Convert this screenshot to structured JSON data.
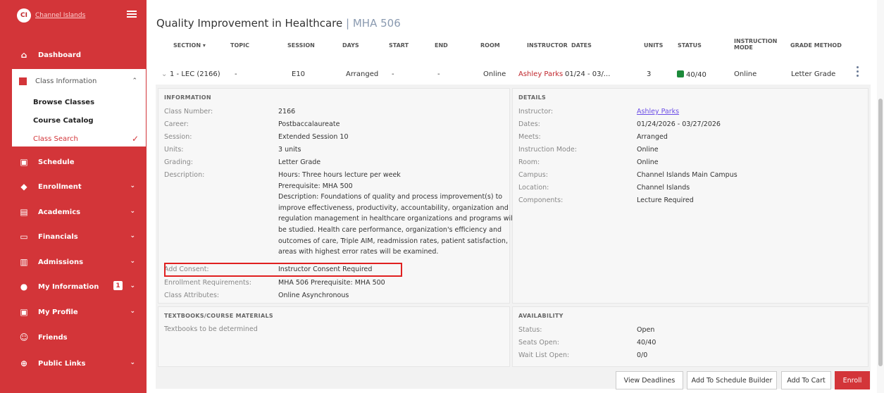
{
  "sidebar": {
    "logo_initials": "CI",
    "logo_text": "Channel Islands",
    "items": [
      {
        "label": "Dashboard",
        "icon": "home-icon"
      },
      {
        "label": "Class Information",
        "icon": "class-info-icon"
      },
      {
        "label": "Schedule",
        "icon": "calendar-icon"
      },
      {
        "label": "Enrollment",
        "icon": "graduation-cap-icon"
      },
      {
        "label": "Academics",
        "icon": "academics-icon"
      },
      {
        "label": "Financials",
        "icon": "credit-card-icon"
      },
      {
        "label": "Admissions",
        "icon": "admissions-icon"
      },
      {
        "label": "My Information",
        "icon": "info-icon",
        "badge": "1"
      },
      {
        "label": "My Profile",
        "icon": "profile-icon"
      },
      {
        "label": "Friends",
        "icon": "smiley-icon"
      },
      {
        "label": "Public Links",
        "icon": "globe-icon"
      }
    ],
    "class_sub": [
      "Browse Classes",
      "Course Catalog",
      "Class Search"
    ]
  },
  "page": {
    "title": "Quality Improvement in Healthcare",
    "code": "| MHA 506"
  },
  "columns": {
    "section": "SECTION ▾",
    "topic": "TOPIC",
    "session": "SESSION",
    "days": "DAYS",
    "start": "START",
    "end": "END",
    "room": "ROOM",
    "instructor": "INSTRUCTOR",
    "dates": "DATES",
    "units": "UNITS",
    "status": "STATUS",
    "instruction_mode_1": "INSTRUCTION",
    "instruction_mode_2": "MODE",
    "grade_method": "GRADE METHOD"
  },
  "row": {
    "section": "1 - LEC (2166)",
    "topic": "-",
    "session": "E10",
    "days": "Arranged",
    "start": "-",
    "end": "-",
    "room": "Online",
    "instructor": "Ashley Parks",
    "dates": "01/24 - 03/...",
    "units": "3",
    "status": "40/40",
    "mode": "Online",
    "grade": "Letter Grade"
  },
  "information": {
    "title": "INFORMATION",
    "labels": {
      "class_number": "Class Number:",
      "career": "Career:",
      "session": "Session:",
      "units": "Units:",
      "grading": "Grading:",
      "description": "Description:",
      "consent": "Add Consent:",
      "requirements": "Enrollment Requirements:",
      "attributes": "Class Attributes:"
    },
    "values": {
      "class_number": "2166",
      "career": "Postbaccalaureate",
      "session": "Extended Session 10",
      "units": "3 units",
      "grading": "Letter Grade",
      "desc_line1": "Hours: Three hours lecture per week",
      "desc_line2": "Prerequisite: MHA 500",
      "desc_line3": "Description: Foundations of quality and process improvement(s) to improve effectiveness, productivity, accountability, organization and regulation management in healthcare organizations and programs will be studied. Health care performance, organization's efficiency and outcomes of care, Triple AIM, readmission rates, patient satisfaction, areas with highest error rates will be examined.",
      "consent": "Instructor Consent Required",
      "requirements": "MHA 506 Prerequisite: MHA 500",
      "attributes": "Online Asynchronous"
    }
  },
  "details": {
    "title": "DETAILS",
    "labels": {
      "instructor": "Instructor:",
      "dates": "Dates:",
      "meets": "Meets:",
      "mode": "Instruction Mode:",
      "room": "Room:",
      "campus": "Campus:",
      "location": "Location:",
      "components": "Components:"
    },
    "values": {
      "instructor": "Ashley Parks",
      "dates": "01/24/2026 - 03/27/2026",
      "meets": "Arranged",
      "mode": "Online",
      "room": "Online",
      "campus": "Channel Islands Main Campus",
      "location": "Channel Islands",
      "components": "Lecture Required"
    }
  },
  "textbooks": {
    "title": "TEXTBOOKS/COURSE MATERIALS",
    "text": "Textbooks to be determined"
  },
  "availability": {
    "title": "AVAILABILITY",
    "labels": {
      "status": "Status:",
      "seats": "Seats Open:",
      "waitlist": "Wait List Open:"
    },
    "values": {
      "status": "Open",
      "seats": "40/40",
      "waitlist": "0/0"
    }
  },
  "buttons": {
    "deadlines": "View Deadlines",
    "schedule_builder": "Add To Schedule Builder",
    "cart": "Add To Cart",
    "enroll": "Enroll"
  },
  "colors": {
    "brand": "#d33539",
    "status_ok": "#1c8a3a",
    "link": "#6b4de6",
    "highlight": "#e02020"
  }
}
